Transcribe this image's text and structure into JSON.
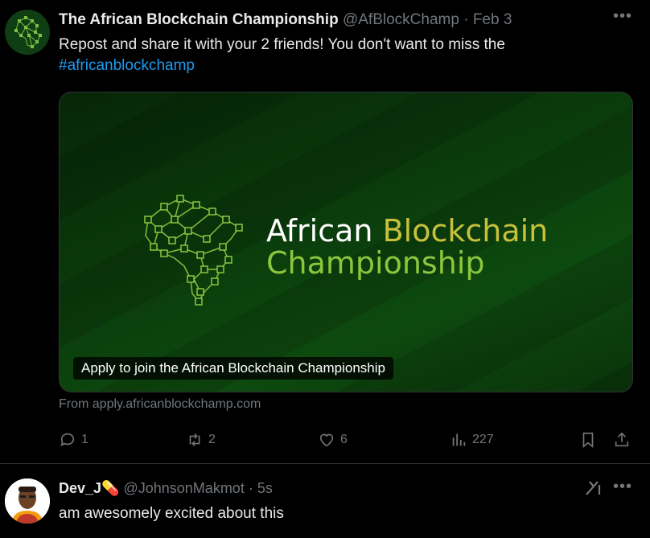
{
  "tweet": {
    "author_name": "The African Blockchain Championship",
    "handle": "@AfBlockChamp",
    "separator": "·",
    "date": "Feb 3",
    "text": "Repost and share it with your 2 friends! You don't want to miss the",
    "hashtag": "#africanblockchamp",
    "card": {
      "title_word1": "African",
      "title_word2": "Blockchain",
      "title_word3": "Championship",
      "label": "Apply to join the African Blockchain Championship",
      "source": "From apply.africanblockchamp.com"
    },
    "actions": {
      "reply_count": "1",
      "repost_count": "2",
      "like_count": "6",
      "views_count": "227"
    }
  },
  "reply": {
    "author_name": "Dev_J",
    "emoji": "💊",
    "handle": "@JohnsonMakmot",
    "separator": "·",
    "time": "5s",
    "text": "am awesomely excited about this"
  },
  "colors": {
    "background": "#000000",
    "text": "#e7e9ea",
    "muted": "#71767b",
    "link": "#1d9bf0",
    "card_green": "#0d4a0e",
    "title_yellow": "#c9c03c",
    "title_green": "#8cc63f"
  }
}
